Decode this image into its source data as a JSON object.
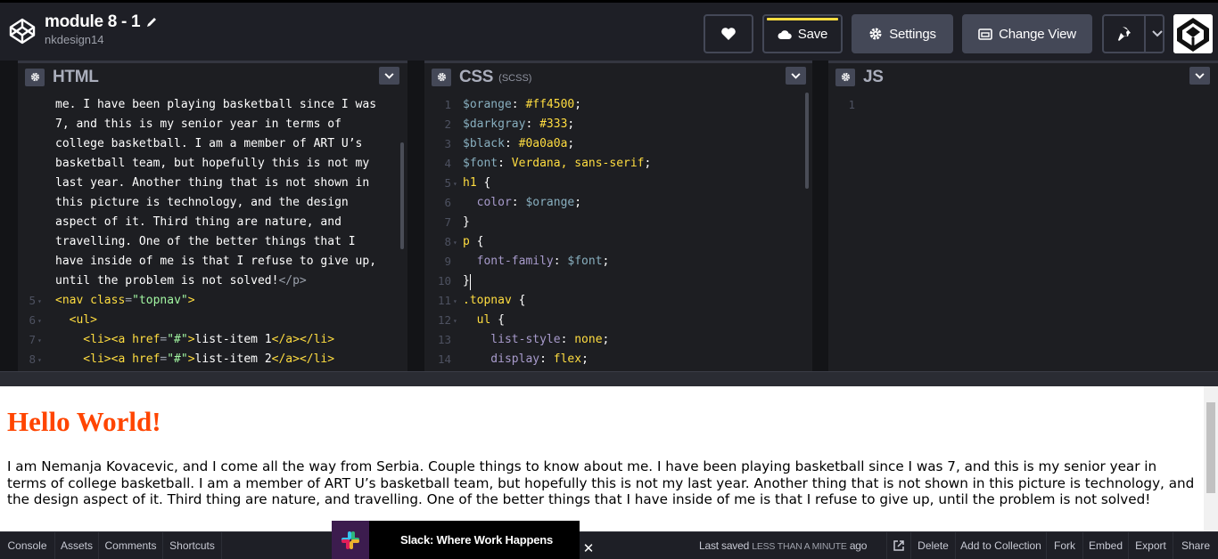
{
  "header": {
    "pen_title": "module 8 - 1",
    "owner": "nkdesign14",
    "save_label": "Save",
    "settings_label": "Settings",
    "change_view_label": "Change View"
  },
  "html_pane": {
    "name": "HTML",
    "gutter": [
      {
        "n": "",
        "fold": false
      },
      {
        "n": "",
        "fold": false
      },
      {
        "n": "",
        "fold": false
      },
      {
        "n": "",
        "fold": false
      },
      {
        "n": "",
        "fold": false
      },
      {
        "n": "",
        "fold": false
      },
      {
        "n": "",
        "fold": false
      },
      {
        "n": "",
        "fold": false
      },
      {
        "n": "",
        "fold": false
      },
      {
        "n": "",
        "fold": false
      },
      {
        "n": "5",
        "fold": true
      },
      {
        "n": "6",
        "fold": true
      },
      {
        "n": "7",
        "fold": true
      },
      {
        "n": "8",
        "fold": true
      }
    ],
    "lines": [
      [
        {
          "t": "me. I have been playing basketball since I was",
          "c": "t-white"
        }
      ],
      [
        {
          "t": "7, and this is my senior year in terms of",
          "c": "t-white"
        }
      ],
      [
        {
          "t": "college basketball. I am a member of ART U’s",
          "c": "t-white"
        }
      ],
      [
        {
          "t": "basketball team, but hopefully this is not my",
          "c": "t-white"
        }
      ],
      [
        {
          "t": "last year. Another thing that is not shown in",
          "c": "t-white"
        }
      ],
      [
        {
          "t": "this picture is technology, and the design",
          "c": "t-white"
        }
      ],
      [
        {
          "t": "aspect of it. Third thing are nature, and",
          "c": "t-white"
        }
      ],
      [
        {
          "t": "travelling. One of the better things that I",
          "c": "t-white"
        }
      ],
      [
        {
          "t": "have inside of me is that I refuse to give up,",
          "c": "t-white"
        }
      ],
      [
        {
          "t": "until the problem is not solved!",
          "c": "t-white"
        },
        {
          "t": "</p>",
          "c": "t-gray"
        }
      ],
      [
        {
          "t": "<nav ",
          "c": "t-yellow"
        },
        {
          "t": "class",
          "c": "t-yellow"
        },
        {
          "t": "=",
          "c": "t-gray"
        },
        {
          "t": "\"topnav\"",
          "c": "t-green"
        },
        {
          "t": ">",
          "c": "t-yellow"
        }
      ],
      [
        {
          "t": "  <ul>",
          "c": "t-yellow"
        }
      ],
      [
        {
          "t": "    <li><a ",
          "c": "t-yellow"
        },
        {
          "t": "href",
          "c": "t-yellow"
        },
        {
          "t": "=",
          "c": "t-gray"
        },
        {
          "t": "\"#\"",
          "c": "t-green"
        },
        {
          "t": ">",
          "c": "t-yellow"
        },
        {
          "t": "list-item 1",
          "c": "t-white"
        },
        {
          "t": "</a></li>",
          "c": "t-yellow"
        }
      ],
      [
        {
          "t": "    <li><a ",
          "c": "t-yellow"
        },
        {
          "t": "href",
          "c": "t-yellow"
        },
        {
          "t": "=",
          "c": "t-gray"
        },
        {
          "t": "\"#\"",
          "c": "t-green"
        },
        {
          "t": ">",
          "c": "t-yellow"
        },
        {
          "t": "list-item 2",
          "c": "t-white"
        },
        {
          "t": "</a></li>",
          "c": "t-yellow"
        }
      ]
    ]
  },
  "css_pane": {
    "name": "CSS",
    "sub": "(SCSS)",
    "gutter": [
      {
        "n": "1",
        "fold": false
      },
      {
        "n": "2",
        "fold": false
      },
      {
        "n": "3",
        "fold": false
      },
      {
        "n": "4",
        "fold": false
      },
      {
        "n": "5",
        "fold": true
      },
      {
        "n": "6",
        "fold": false
      },
      {
        "n": "7",
        "fold": false
      },
      {
        "n": "8",
        "fold": true
      },
      {
        "n": "9",
        "fold": false
      },
      {
        "n": "10",
        "fold": false
      },
      {
        "n": "11",
        "fold": true
      },
      {
        "n": "12",
        "fold": true
      },
      {
        "n": "13",
        "fold": false
      },
      {
        "n": "14",
        "fold": false
      }
    ],
    "lines": [
      [
        {
          "t": "$orange",
          "c": "t-var"
        },
        {
          "t": ": ",
          "c": "t-white"
        },
        {
          "t": "#ff4500",
          "c": "t-val"
        },
        {
          "t": ";",
          "c": "t-white"
        }
      ],
      [
        {
          "t": "$darkgray",
          "c": "t-var"
        },
        {
          "t": ": ",
          "c": "t-white"
        },
        {
          "t": "#333",
          "c": "t-val"
        },
        {
          "t": ";",
          "c": "t-white"
        }
      ],
      [
        {
          "t": "$black",
          "c": "t-var"
        },
        {
          "t": ": ",
          "c": "t-white"
        },
        {
          "t": "#0a0a0a",
          "c": "t-val"
        },
        {
          "t": ";",
          "c": "t-white"
        }
      ],
      [
        {
          "t": "$font",
          "c": "t-var"
        },
        {
          "t": ": ",
          "c": "t-white"
        },
        {
          "t": "Verdana, sans-serif",
          "c": "t-val"
        },
        {
          "t": ";",
          "c": "t-white"
        }
      ],
      [
        {
          "t": "h1",
          "c": "t-val"
        },
        {
          "t": " {",
          "c": "t-white"
        }
      ],
      [
        {
          "t": "  color",
          "c": "t-prop"
        },
        {
          "t": ": ",
          "c": "t-white"
        },
        {
          "t": "$orange",
          "c": "t-var"
        },
        {
          "t": ";",
          "c": "t-white"
        }
      ],
      [
        {
          "t": "}",
          "c": "t-white"
        }
      ],
      [
        {
          "t": "p",
          "c": "t-val"
        },
        {
          "t": " {",
          "c": "t-white"
        }
      ],
      [
        {
          "t": "  font-family",
          "c": "t-prop"
        },
        {
          "t": ": ",
          "c": "t-white"
        },
        {
          "t": "$font",
          "c": "t-var"
        },
        {
          "t": ";",
          "c": "t-white"
        }
      ],
      [
        {
          "t": "}",
          "c": "t-white"
        }
      ],
      [
        {
          "t": ".topnav",
          "c": "t-val"
        },
        {
          "t": " {",
          "c": "t-white"
        }
      ],
      [
        {
          "t": "  ul",
          "c": "t-val"
        },
        {
          "t": " {",
          "c": "t-white"
        }
      ],
      [
        {
          "t": "    list-style",
          "c": "t-prop"
        },
        {
          "t": ": ",
          "c": "t-white"
        },
        {
          "t": "none",
          "c": "t-val"
        },
        {
          "t": ";",
          "c": "t-white"
        }
      ],
      [
        {
          "t": "    display",
          "c": "t-prop"
        },
        {
          "t": ": ",
          "c": "t-white"
        },
        {
          "t": "flex",
          "c": "t-val"
        },
        {
          "t": ";",
          "c": "t-white"
        }
      ]
    ]
  },
  "js_pane": {
    "name": "JS",
    "gutter": [
      {
        "n": "1",
        "fold": false
      }
    ],
    "lines": []
  },
  "preview": {
    "heading": "Hello World!",
    "paragraph": "I am Nemanja Kovacevic, and I come all the way from Serbia. Couple things to know about me. I have been playing basketball since I was 7, and this is my senior year in terms of college basketball. I am a member of ART U’s basketball team, but hopefully this is not my last year. Another thing that is not shown in this picture is technology, and the design aspect of it. Third thing are nature, and travelling. One of the better things that I have inside of me is that I refuse to give up, until the problem is not solved!"
  },
  "footer": {
    "console": "Console",
    "assets": "Assets",
    "comments": "Comments",
    "shortcuts": "Shortcuts",
    "last_saved_prefix": "Last saved",
    "last_saved_when": "LESS THAN A MINUTE",
    "last_saved_suffix": "ago",
    "delete": "Delete",
    "add_to_collection": "Add to Collection",
    "fork": "Fork",
    "embed": "Embed",
    "export": "Export",
    "share": "Share"
  },
  "ad": {
    "text": "Slack: Where Work Happens",
    "close": "✕"
  }
}
